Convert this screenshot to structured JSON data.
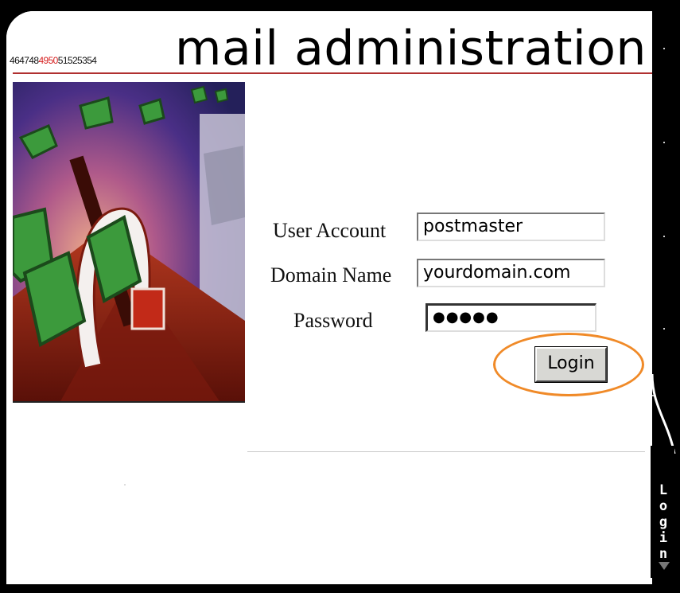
{
  "header": {
    "ticker_prefix": "464748",
    "ticker_highlight": "4950",
    "ticker_suffix": "51525354",
    "title": "mail administration",
    "accent_color": "#b03030",
    "ticker_highlight_color": "#d62020"
  },
  "login_form": {
    "user_account_label": "User Account",
    "user_account_value": "postmaster",
    "domain_name_label": "Domain Name",
    "domain_name_value": "yourdomain.com",
    "password_label": "Password",
    "password_value": "●●●●●",
    "login_button_label": "Login",
    "highlight_color": "#f08a28"
  },
  "side_tab": {
    "label": "Login",
    "arrow_icon": "triangle-down-icon"
  },
  "hero_image": {
    "icon": "mailbox-letters-illustration"
  }
}
